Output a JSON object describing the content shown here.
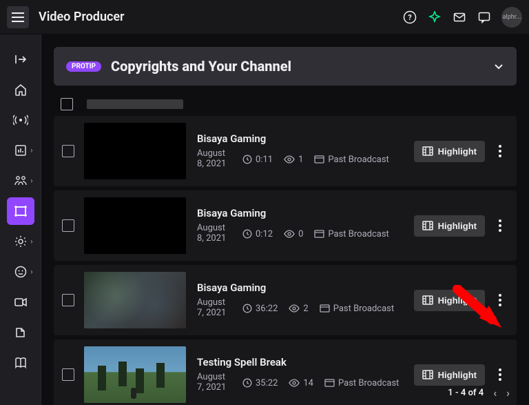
{
  "header": {
    "title": "Video Producer",
    "avatar_label": "alphr..."
  },
  "protip": {
    "badge": "PROTIP",
    "title": "Copyrights and Your Channel"
  },
  "highlight_label": "Highlight",
  "videos": [
    {
      "title": "Bisaya Gaming",
      "date": "August 8, 2021",
      "duration": "0:11",
      "views": "1",
      "type": "Past Broadcast",
      "thumb_class": "black"
    },
    {
      "title": "Bisaya Gaming",
      "date": "August 8, 2021",
      "duration": "0:12",
      "views": "0",
      "type": "Past Broadcast",
      "thumb_class": "black"
    },
    {
      "title": "Bisaya Gaming",
      "date": "August 7, 2021",
      "duration": "36:22",
      "views": "2",
      "type": "Past Broadcast",
      "thumb_class": "game1"
    },
    {
      "title": "Testing Spell Break",
      "date": "August 7, 2021",
      "duration": "35:22",
      "views": "14",
      "type": "Past Broadcast",
      "thumb_class": "game2"
    }
  ],
  "pagination": {
    "label": "1 - 4 of 4"
  }
}
